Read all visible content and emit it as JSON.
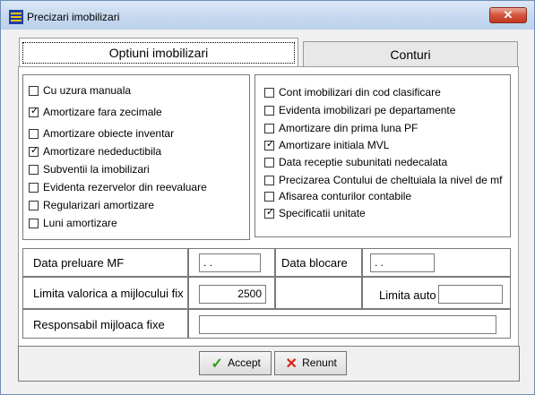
{
  "window": {
    "title": "Precizari imobilizari",
    "close_symbol": "✕"
  },
  "tabs": [
    {
      "label": "Optiuni imobilizari",
      "active": true
    },
    {
      "label": "Conturi",
      "active": false
    }
  ],
  "left_options": [
    {
      "label": "Cu uzura manuala",
      "checked": false
    },
    {
      "label": "Amortizare fara zecimale",
      "checked": true
    },
    {
      "label": "Amortizare obiecte inventar",
      "checked": false
    },
    {
      "label": "Amortizare nedeductibila",
      "checked": true
    },
    {
      "label": "Subventii la imobilizari",
      "checked": false
    },
    {
      "label": "Evidenta  rezervelor din reevaluare",
      "checked": false
    },
    {
      "label": "Regularizari amortizare",
      "checked": false
    },
    {
      "label": "Luni amortizare",
      "checked": false
    }
  ],
  "right_options": [
    {
      "label": "Cont imobilizari din cod clasificare",
      "checked": false
    },
    {
      "label": "Evidenta  imobilizari pe departamente",
      "checked": false
    },
    {
      "label": "Amortizare din prima luna PF",
      "checked": false
    },
    {
      "label": "Amortizare  initiala MVL",
      "checked": true
    },
    {
      "label": "Data receptie subunitati  nedecalata",
      "checked": false
    },
    {
      "label": "Precizarea Contului de cheltuiala la nivel de mf",
      "checked": false
    },
    {
      "label": "Afisarea conturilor contabile",
      "checked": false
    },
    {
      "label": "Specificatii unitate",
      "checked": true
    }
  ],
  "fields": {
    "data_preluare_label": "Data preluare MF",
    "data_preluare_value": " . .",
    "data_blocare_label": "Data blocare",
    "data_blocare_value": " . .",
    "limita_valorica_label": "Limita valorica a mijlocului fix",
    "limita_valorica_value": "2500",
    "limita_auto_label": "Limita auto",
    "limita_auto_value": "",
    "responsabil_label": "Responsabil mijloaca fixe",
    "responsabil_value": ""
  },
  "buttons": {
    "accept_label": "Accept",
    "accept_icon": "✓",
    "renunt_label": "Renunt",
    "renunt_icon": "✕"
  }
}
